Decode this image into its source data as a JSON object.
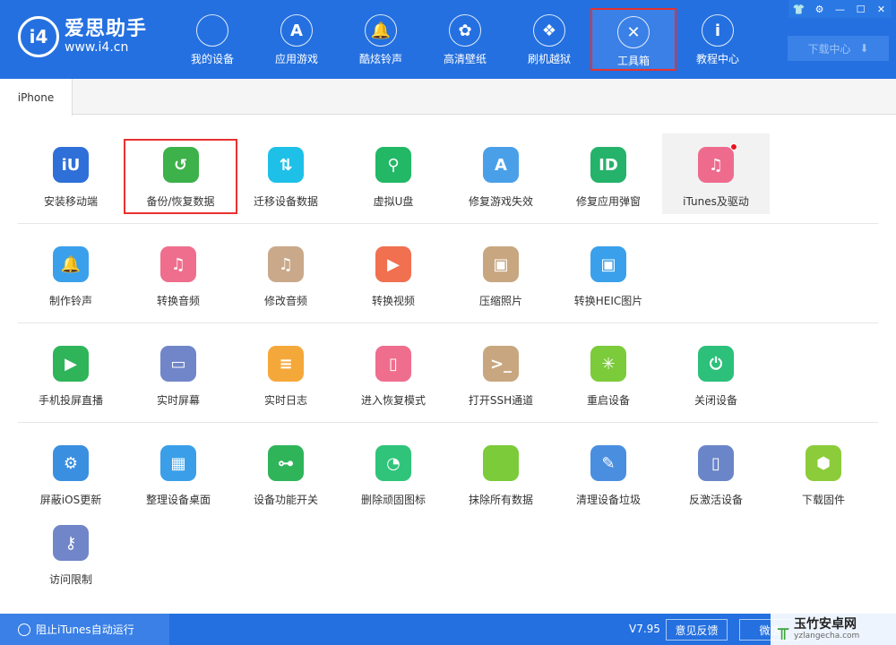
{
  "app": {
    "name": "爱思助手",
    "url": "www.i4.cn",
    "logo_mark": "i4"
  },
  "nav": [
    {
      "label": "我的设备",
      "icon": "apple-icon",
      "glyph": ""
    },
    {
      "label": "应用游戏",
      "icon": "app-store-icon",
      "glyph": "A"
    },
    {
      "label": "酷炫铃声",
      "icon": "bell-icon",
      "glyph": "🔔"
    },
    {
      "label": "高清壁纸",
      "icon": "flower-icon",
      "glyph": "✿"
    },
    {
      "label": "刷机越狱",
      "icon": "box-icon",
      "glyph": "❖"
    },
    {
      "label": "工具箱",
      "icon": "tools-icon",
      "glyph": "✕",
      "selected": true
    },
    {
      "label": "教程中心",
      "icon": "info-icon",
      "glyph": "i"
    }
  ],
  "window_controls": [
    {
      "icon": "skin-icon",
      "glyph": "👕"
    },
    {
      "icon": "gear-icon",
      "glyph": "⚙"
    },
    {
      "icon": "minimize-icon",
      "glyph": "—"
    },
    {
      "icon": "maximize-icon",
      "glyph": "☐"
    },
    {
      "icon": "close-icon",
      "glyph": "✕"
    }
  ],
  "download_center": {
    "label": "下载中心",
    "icon": "download-icon",
    "glyph": "⬇"
  },
  "tab": {
    "label": "iPhone"
  },
  "tools": [
    [
      {
        "label": "安装移动端",
        "color": "#2f6fd8",
        "glyph": "iU"
      },
      {
        "label": "备份/恢复数据",
        "color": "#3db14a",
        "glyph": "↺",
        "boxed": true
      },
      {
        "label": "迁移设备数据",
        "color": "#1ec0e8",
        "glyph": "⇅"
      },
      {
        "label": "虚拟U盘",
        "color": "#22b866",
        "glyph": "⚲"
      },
      {
        "label": "修复游戏失效",
        "color": "#4aa0e8",
        "glyph": "A"
      },
      {
        "label": "修复应用弹窗",
        "color": "#25b26a",
        "glyph": "ID"
      },
      {
        "label": "iTunes及驱动",
        "color": "#ee6b8e",
        "glyph": "♫",
        "highlight": true,
        "badge": true
      }
    ],
    [
      {
        "label": "制作铃声",
        "color": "#3aa0ec",
        "glyph": "🔔"
      },
      {
        "label": "转换音频",
        "color": "#ef6e8d",
        "glyph": "♫"
      },
      {
        "label": "修改音频",
        "color": "#c9a98a",
        "glyph": "♫"
      },
      {
        "label": "转换视频",
        "color": "#f07050",
        "glyph": "▶"
      },
      {
        "label": "压缩照片",
        "color": "#c8a780",
        "glyph": "▣"
      },
      {
        "label": "转换HEIC图片",
        "color": "#3aa0ec",
        "glyph": "▣"
      }
    ],
    [
      {
        "label": "手机投屏直播",
        "color": "#2fb45a",
        "glyph": "▶"
      },
      {
        "label": "实时屏幕",
        "color": "#7186c8",
        "glyph": "▭"
      },
      {
        "label": "实时日志",
        "color": "#f5a83a",
        "glyph": "≡"
      },
      {
        "label": "进入恢复模式",
        "color": "#ef6e8d",
        "glyph": "▯"
      },
      {
        "label": "打开SSH通道",
        "color": "#c8a780",
        "glyph": ">_"
      },
      {
        "label": "重启设备",
        "color": "#7ccb3a",
        "glyph": "✳"
      },
      {
        "label": "关闭设备",
        "color": "#2cc07a",
        "glyph": "⏻"
      }
    ],
    [
      {
        "label": "屏蔽iOS更新",
        "color": "#3a8fe0",
        "glyph": "⚙"
      },
      {
        "label": "整理设备桌面",
        "color": "#3a9fe8",
        "glyph": "▦"
      },
      {
        "label": "设备功能开关",
        "color": "#2fb45a",
        "glyph": "⊶"
      },
      {
        "label": "删除顽固图标",
        "color": "#2fc47a",
        "glyph": "◔"
      },
      {
        "label": "抹除所有数据",
        "color": "#7ccb3a",
        "glyph": ""
      },
      {
        "label": "清理设备垃圾",
        "color": "#4a8ee0",
        "glyph": "✎"
      },
      {
        "label": "反激活设备",
        "color": "#6a86c8",
        "glyph": "▯"
      },
      {
        "label": "下载固件",
        "color": "#8ccc3a",
        "glyph": "⬢"
      }
    ],
    [
      {
        "label": "访问限制",
        "color": "#7186c8",
        "glyph": "⚷"
      }
    ]
  ],
  "footer": {
    "itunes_block": "阻止iTunes自动运行",
    "version": "V7.95",
    "feedback": "意见反馈",
    "wechat": "微信"
  },
  "watermark": {
    "name": "玉竹安卓网",
    "url": "yzlangecha.com"
  },
  "colors": {
    "header": "#2470e0",
    "selection_outline": "#e8312f"
  }
}
